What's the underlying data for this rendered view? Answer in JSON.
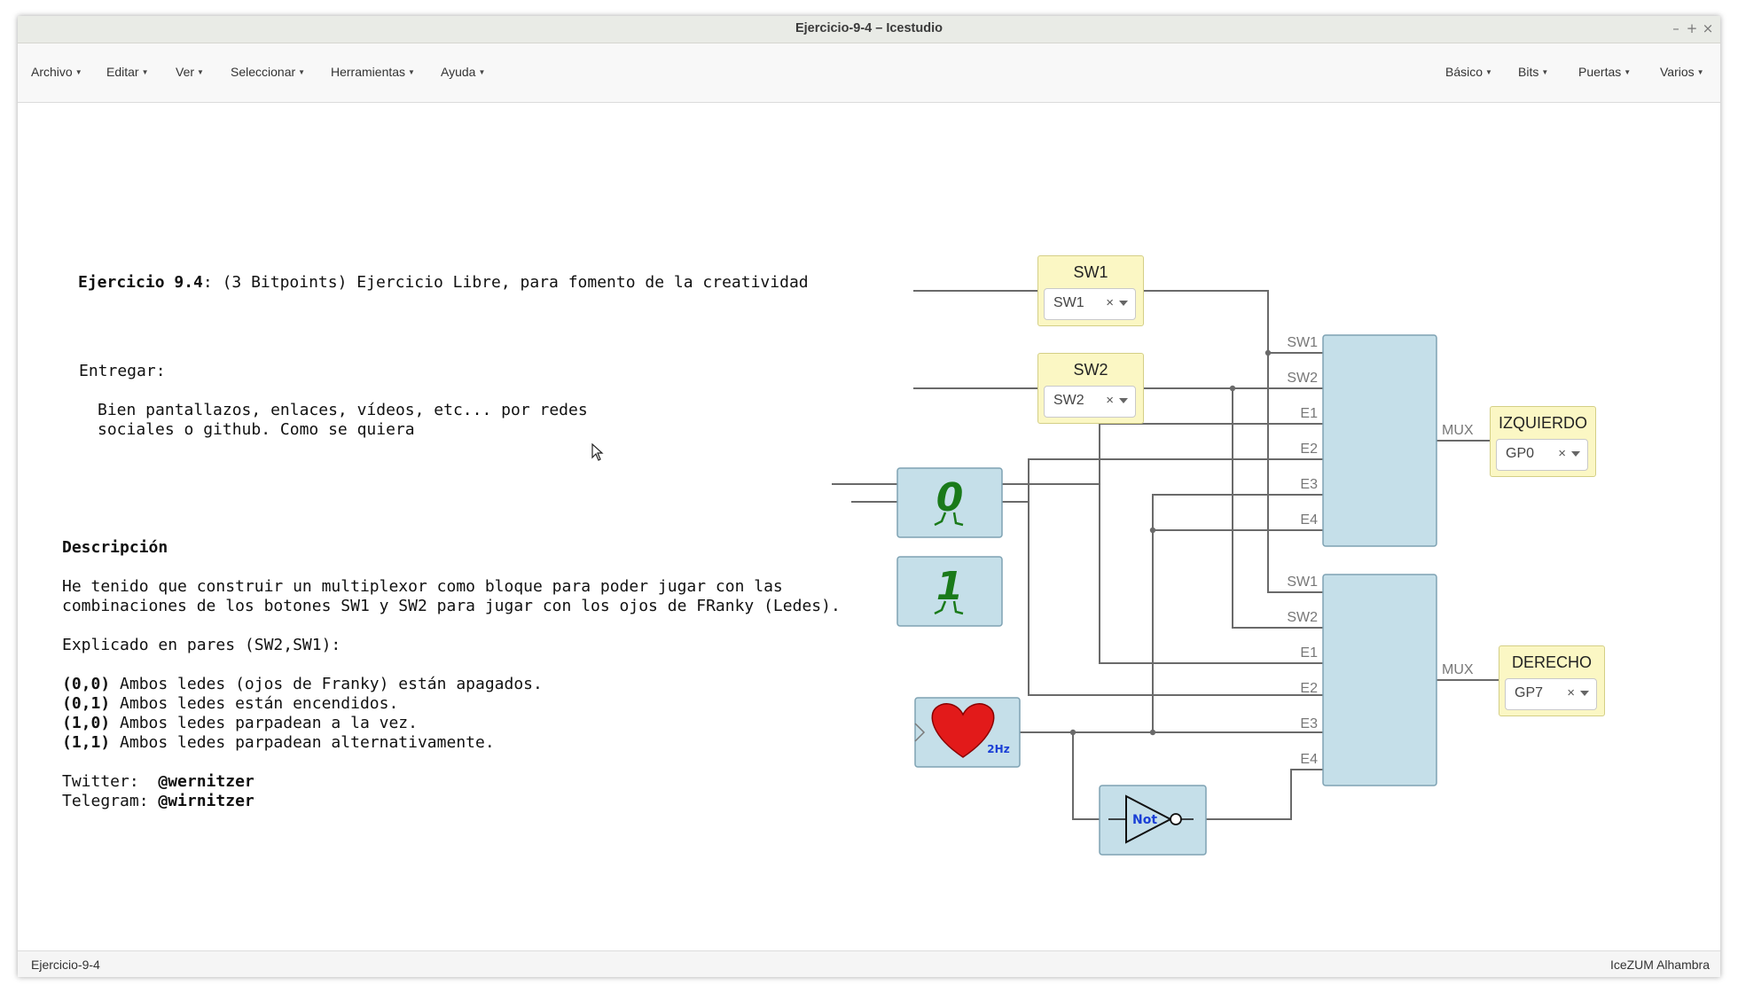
{
  "window": {
    "title": "Ejercicio-9-4 – Icestudio",
    "controls": {
      "minimize": "–",
      "maximize": "+",
      "close": "×"
    }
  },
  "menu": {
    "left": [
      "Archivo",
      "Editar",
      "Ver",
      "Seleccionar",
      "Herramientas",
      "Ayuda"
    ],
    "right": [
      "Básico",
      "Bits",
      "Puertas",
      "Varios"
    ]
  },
  "notes": {
    "heading_bold": "Ejercicio 9.4",
    "heading_rest": ": (3 Bitpoints) Ejercicio Libre, para fomento de la creatividad",
    "entregar": "Entregar:",
    "entregar_line1": "Bien pantallazos, enlaces, vídeos, etc... por redes",
    "entregar_line2": "sociales o github. Como se quiera",
    "descripcion": "Descripción",
    "desc_line1": "He tenido que construir un multiplexor como bloque para poder jugar con las",
    "desc_line2": "combinaciones de los botones SW1 y SW2 para jugar con los ojos de FRanky (Ledes).",
    "pares": "Explicado en pares (SW2,SW1):",
    "p1_code": "(0,0)",
    "p1_text": " Ambos ledes (ojos de Franky) están apagados.",
    "p2_code": "(0,1)",
    "p2_text": " Ambos ledes están encendidos.",
    "p3_code": "(1,0)",
    "p3_text": " Ambos ledes parpadean a la vez.",
    "p4_code": "(1,1)",
    "p4_text": " Ambos ledes parpadean alternativamente.",
    "twitter_label": "Twitter:  ",
    "twitter_handle": "@wernitzer",
    "telegram_label": "Telegram: ",
    "telegram_handle": "@wirnitzer"
  },
  "circuit": {
    "inputs": [
      {
        "title": "SW1",
        "pin": "SW1"
      },
      {
        "title": "SW2",
        "pin": "SW2"
      }
    ],
    "outputs": [
      {
        "title": "IZQUIERDO",
        "pin": "GP0"
      },
      {
        "title": "DERECHO",
        "pin": "GP7"
      }
    ],
    "constants": [
      "0",
      "1"
    ],
    "clock_label": "2Hz",
    "not_label": "Not",
    "mux_inputs": [
      "SW1",
      "SW2",
      "E1",
      "E2",
      "E3",
      "E4"
    ],
    "mux_output": "MUX",
    "colors": {
      "pin_block": "#fbf7c4",
      "logic_block": "#c5dfe9",
      "wire": "#666666",
      "heart": "#e21a1a",
      "constant": "#1a7a1a",
      "not_text": "#1a3fd6"
    }
  },
  "status": {
    "left": "Ejercicio-9-4",
    "right": "IceZUM Alhambra"
  }
}
